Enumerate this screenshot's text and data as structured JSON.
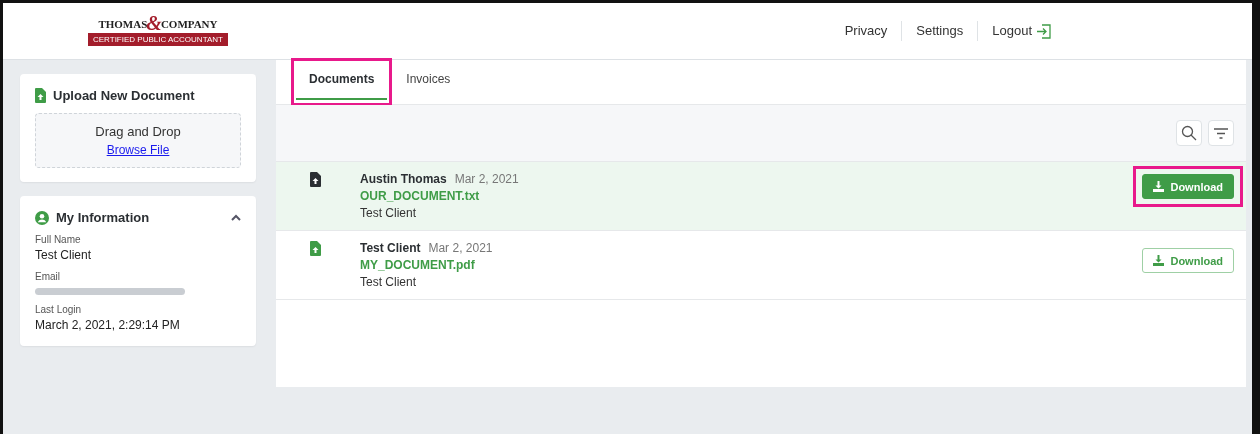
{
  "logo": {
    "name_left": "THOMAS",
    "ampersand": "&",
    "name_right": "COMPANY",
    "tagline": "CERTIFIED PUBLIC ACCOUNTANT"
  },
  "nav": [
    "Privacy",
    "Settings",
    "Logout"
  ],
  "upload": {
    "title": "Upload New Document",
    "drop_text": "Drag and Drop",
    "browse_link": "Browse File"
  },
  "my_information": {
    "title": "My Information",
    "expanded": true,
    "fields": [
      {
        "label": "Full Name",
        "value": "Test Client",
        "redacted": false
      },
      {
        "label": "Email",
        "redacted": true
      },
      {
        "label": "Last Login",
        "value": "March 2, 2021, 2:29:14 PM",
        "redacted": false
      }
    ]
  },
  "tabs": [
    {
      "label": "Documents",
      "selected": true,
      "highlighted": true
    },
    {
      "label": "Invoices",
      "selected": false,
      "highlighted": false
    }
  ],
  "documents": [
    {
      "author": "Austin Thomas",
      "date": "Mar 2, 2021",
      "file": "OUR_DOCUMENT.txt",
      "client": "Test Client",
      "selected": true,
      "button": "Download",
      "highlighted": true
    },
    {
      "author": "Test Client",
      "date": "Mar 2, 2021",
      "file": "MY_DOCUMENT.pdf",
      "client": "Test Client",
      "selected": false,
      "button": "Download",
      "highlighted": false
    }
  ]
}
